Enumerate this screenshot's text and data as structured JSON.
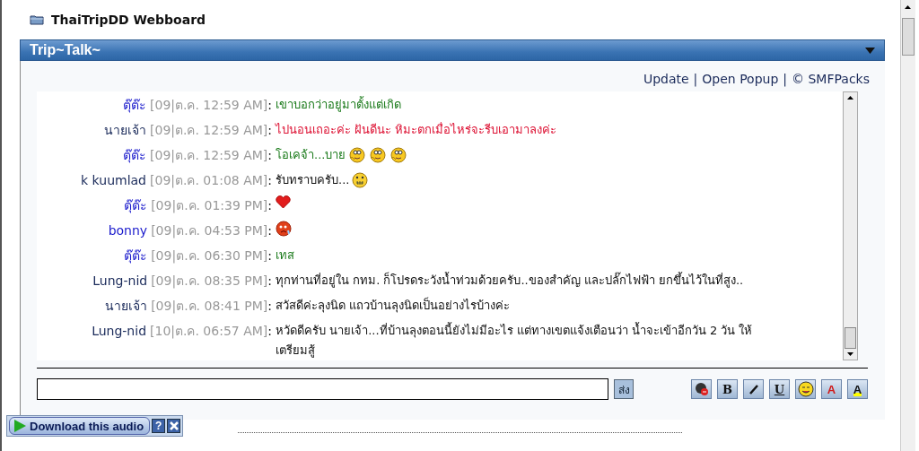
{
  "site_title": "ThaiTripDD Webboard",
  "panel": {
    "title": "Trip~Talk~"
  },
  "links": [
    "Update",
    "Open Popup",
    "© SMFPacks"
  ],
  "link_separators": [
    "|",
    "|"
  ],
  "messages": [
    {
      "author": {
        "name": "ตุ๊ต๊ะ",
        "color": "#1a1acc"
      },
      "time": "[09|ต.ค. 12:59 AM]",
      "separator": ":",
      "text": "เขาบอกว่าอยู่มาตั้งแต่เกิด",
      "color": "#1a7a1a"
    },
    {
      "author": {
        "name": "นายเจ้า",
        "color": "#1a2a5a"
      },
      "time": "[09|ต.ค. 12:59 AM]",
      "separator": ":",
      "text": "ไปนอนเถอะค่ะ ฝันดีนะ หิมะตกเมื่อไหร่จะรีบเอามาลงค่ะ",
      "color": "#dd1133"
    },
    {
      "author": {
        "name": "ตุ๊ต๊ะ",
        "color": "#1a1acc"
      },
      "time": "[09|ต.ค. 12:59 AM]",
      "separator": ":",
      "text": "โอเคจ้า...บาย",
      "color": "#1a7a1a",
      "emoticons": [
        {
          "kind": "thinking"
        },
        {
          "kind": "thinking"
        },
        {
          "kind": "thinking"
        }
      ]
    },
    {
      "author": {
        "name": "k kuumlad",
        "color": "#1a2a5a"
      },
      "time": "[09|ต.ค. 01:08 AM]",
      "separator": ":",
      "text": "รับทราบครับ...",
      "color": "#111111",
      "emoticons": [
        {
          "kind": "zipped"
        }
      ]
    },
    {
      "author": {
        "name": "ตุ๊ต๊ะ",
        "color": "#1a1acc"
      },
      "time": "[09|ต.ค. 01:39 PM]",
      "separator": ":",
      "emoticons": [
        {
          "kind": "heart"
        }
      ]
    },
    {
      "author": {
        "name": "bonny",
        "color": "#1a1acc"
      },
      "time": "[09|ต.ค. 04:53 PM]",
      "separator": ":",
      "emoticons": [
        {
          "kind": "crying"
        }
      ]
    },
    {
      "author": {
        "name": "ตุ๊ต๊ะ",
        "color": "#1a1acc"
      },
      "time": "[09|ต.ค. 06:30 PM]",
      "separator": ":",
      "text": "เทส",
      "color": "#1a7a1a"
    },
    {
      "author": {
        "name": "Lung-nid",
        "color": "#1a2a5a"
      },
      "time": "[09|ต.ค. 08:35 PM]",
      "separator": ":",
      "text": "ทุกท่านที่อยู่ใน กทม. ก็โปรดระวังน้ำท่วมด้วยครับ..ของสำคัญ และปลั๊กไฟฟ้า ยกขึ้นไว้ในที่สูง..",
      "color": "#111111"
    },
    {
      "author": {
        "name": "นายเจ้า",
        "color": "#1a2a5a"
      },
      "time": "[09|ต.ค. 08:41 PM]",
      "separator": ":",
      "text": "สวัสดีค่ะลุงนิด แถวบ้านลุงนิดเป็นอย่างไรบ้างค่ะ",
      "color": "#111111"
    },
    {
      "author": {
        "name": "Lung-nid",
        "color": "#1a2a5a"
      },
      "time": "[10|ต.ค. 06:57 AM]",
      "separator": ":",
      "text": "หวัดดีครับ นายเจ้า...ที่บ้านลุงตอนนี้ยังไม่มีอะไร แต่ทางเขตแจ้งเตือนว่า น้ำจะเข้าอีกวัน 2 วัน ให้เตรียมสู้",
      "color": "#111111"
    }
  ],
  "send_button": "ส่ง",
  "toolbar": [
    {
      "kind": "sound"
    },
    {
      "kind": "bold",
      "label": "B"
    },
    {
      "kind": "italic"
    },
    {
      "kind": "underline",
      "label": "U"
    },
    {
      "kind": "smiley"
    },
    {
      "kind": "font-color",
      "label": "A"
    },
    {
      "kind": "highlight",
      "label": "A"
    }
  ],
  "audio_bar": {
    "button": "Download this audio",
    "help": "?"
  }
}
